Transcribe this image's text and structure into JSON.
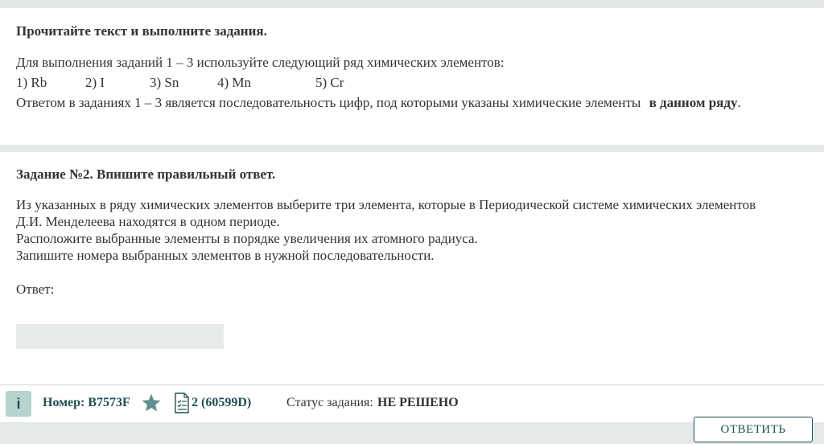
{
  "intro": {
    "heading": "Прочитайте текст и выполните задания.",
    "instruction": "Для выполнения заданий 1 – 3 используйте следующий ряд химических элементов:",
    "options": [
      "1) Rb",
      "2) I",
      "3) Sn",
      "4) Mn",
      "5) Cr"
    ],
    "note_prefix": "Ответом в заданиях 1 – 3 является последовательность цифр, под которыми указаны химические элементы ",
    "note_bold": "в данном ряду",
    "note_suffix": "."
  },
  "task": {
    "heading": "Задание №2. Впишите правильный ответ.",
    "line1": "Из указанных в ряду химических элементов выберите три элемента, которые в Периодической системе химических элементов",
    "line2": "Д.И. Менделеева находятся в одном периоде.",
    "line3": "Расположите выбранные элементы в порядке увеличения их атомного радиуса.",
    "line4": "Запишите номера выбранных элементов в нужной последовательности.",
    "answer_label": "Ответ:",
    "answer_value": ""
  },
  "footer": {
    "info_label": "i",
    "number_text": "Номер: B7573F",
    "doc_text": "2 (60599D)",
    "status_label": "Статус задания:",
    "status_value": "НЕ РЕШЕНО",
    "submit_label": "ОТВЕТИТЬ"
  },
  "icons": {
    "info": "info-icon",
    "star": "star-icon",
    "document": "document-checklist-icon"
  },
  "colors": {
    "accent": "#1f4f52",
    "background": "#e4e8e8",
    "info_bg": "#b7d3d0",
    "star": "#5f8f8e"
  }
}
